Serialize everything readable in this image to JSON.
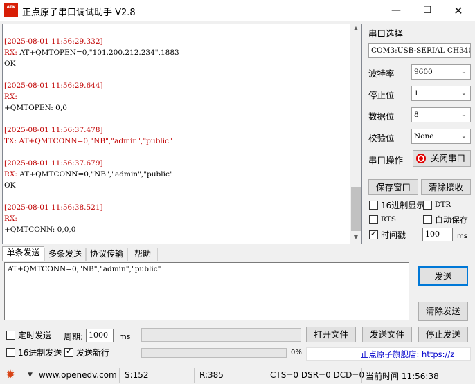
{
  "window": {
    "logo": "ATK\nALIENTEK",
    "title": "正点原子串口调试助手 V2.8",
    "min": "—",
    "max": "☐",
    "close": "✕"
  },
  "receive": {
    "lines": [
      {
        "cls": "ts",
        "text": "[2025-08-01 11:56:29.332]"
      },
      {
        "cls": "rx",
        "prefix": "RX: ",
        "text": "AT+QMTOPEN=0,\"101.200.212.234\",1883"
      },
      {
        "cls": "plain",
        "text": "OK"
      },
      {
        "cls": "plain",
        "text": ""
      },
      {
        "cls": "ts",
        "text": "[2025-08-01 11:56:29.644]"
      },
      {
        "cls": "rx",
        "prefix": "RX: ",
        "text": ""
      },
      {
        "cls": "plain",
        "text": "+QMTOPEN: 0,0"
      },
      {
        "cls": "plain",
        "text": ""
      },
      {
        "cls": "ts",
        "text": "[2025-08-01 11:56:37.478]"
      },
      {
        "cls": "tx",
        "prefix": "TX: ",
        "text": "AT+QMTCONN=0,\"NB\",\"admin\",\"public\""
      },
      {
        "cls": "plain",
        "text": ""
      },
      {
        "cls": "ts",
        "text": "[2025-08-01 11:56:37.679]"
      },
      {
        "cls": "rx",
        "prefix": "RX: ",
        "text": "AT+QMTCONN=0,\"NB\",\"admin\",\"public\""
      },
      {
        "cls": "plain",
        "text": "OK"
      },
      {
        "cls": "plain",
        "text": ""
      },
      {
        "cls": "ts",
        "text": "[2025-08-01 11:56:38.521]"
      },
      {
        "cls": "rx",
        "prefix": "RX: ",
        "text": ""
      },
      {
        "cls": "plain",
        "text": "+QMTCONN: 0,0,0"
      }
    ]
  },
  "panel": {
    "port_select_label": "串口选择",
    "port_value": "COM3:USB-SERIAL CH340",
    "baud_label": "波特率",
    "baud_value": "9600",
    "stop_label": "停止位",
    "stop_value": "1",
    "data_label": "数据位",
    "data_value": "8",
    "parity_label": "校验位",
    "parity_value": "None",
    "port_op_label": "串口操作",
    "close_port_button": "关闭串口",
    "save_window_button": "保存窗口",
    "clear_receive_button": "清除接收",
    "hex_display_label": "16进制显示",
    "dtr_label": "DTR",
    "rts_label": "RTS",
    "auto_save_label": "自动保存",
    "timestamp_label": "时间戳",
    "timestamp_value": "100",
    "timestamp_unit": "ms"
  },
  "tabs": [
    "单条发送",
    "多条发送",
    "协议传输",
    "帮助"
  ],
  "send": {
    "text": "AT+QMTCONN=0,\"NB\",\"admin\",\"public\"",
    "send_button": "发送",
    "clear_send_button": "清除发送",
    "timed_send_label": "定时发送",
    "period_label": "周期:",
    "period_value": "1000",
    "period_unit": "ms",
    "open_file_button": "打开文件",
    "send_file_button": "发送文件",
    "stop_send_button": "停止发送",
    "hex_send_label": "16进制发送",
    "send_newline_label": "发送新行",
    "progress_text": "0%",
    "banner_text": "正点原子旗舰店: https://z"
  },
  "status": {
    "website": "www.openedv.com",
    "s_count": "S:152",
    "r_count": "R:385",
    "signals": "CTS=0 DSR=0 DCD=0",
    "time_label": "当前时间 11:56:38"
  },
  "colors": {
    "timestamp": "#c00000",
    "led_red": "#e00000",
    "logo_red": "#d81e06"
  }
}
